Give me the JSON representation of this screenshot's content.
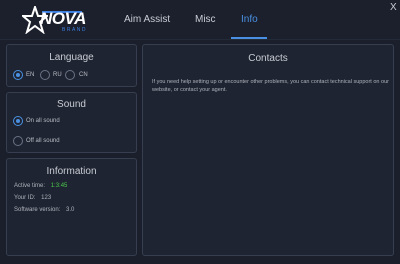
{
  "app": {
    "logo_text": "NOVA",
    "logo_sub": "BRAND"
  },
  "nav": {
    "tabs": [
      {
        "label": "Aim Assist"
      },
      {
        "label": "Misc"
      },
      {
        "label": "Info"
      }
    ],
    "active_tab": "Info",
    "close_glyph": "X"
  },
  "language": {
    "title": "Language",
    "options": [
      {
        "label": "EN",
        "selected": true
      },
      {
        "label": "RU",
        "selected": false
      },
      {
        "label": "CN",
        "selected": false
      }
    ]
  },
  "sound": {
    "title": "Sound",
    "options": [
      {
        "label": "On all sound",
        "selected": true
      },
      {
        "label": "Off all sound",
        "selected": false
      }
    ]
  },
  "information": {
    "title": "Information",
    "active_time_label": "Active time:",
    "active_time_value": "1:3:45",
    "id_label": "Your ID:",
    "id_value": "123",
    "version_label": "Software version:",
    "version_value": "3.0"
  },
  "contacts": {
    "title": "Contacts",
    "text": "If you need help setting up or encounter other problems, you can contact technical support on our website, or contact your agent."
  },
  "colors": {
    "accent": "#4a90e2",
    "background": "#1a1f2b",
    "panel": "#1e2431",
    "active_time": "#4cc94c"
  }
}
